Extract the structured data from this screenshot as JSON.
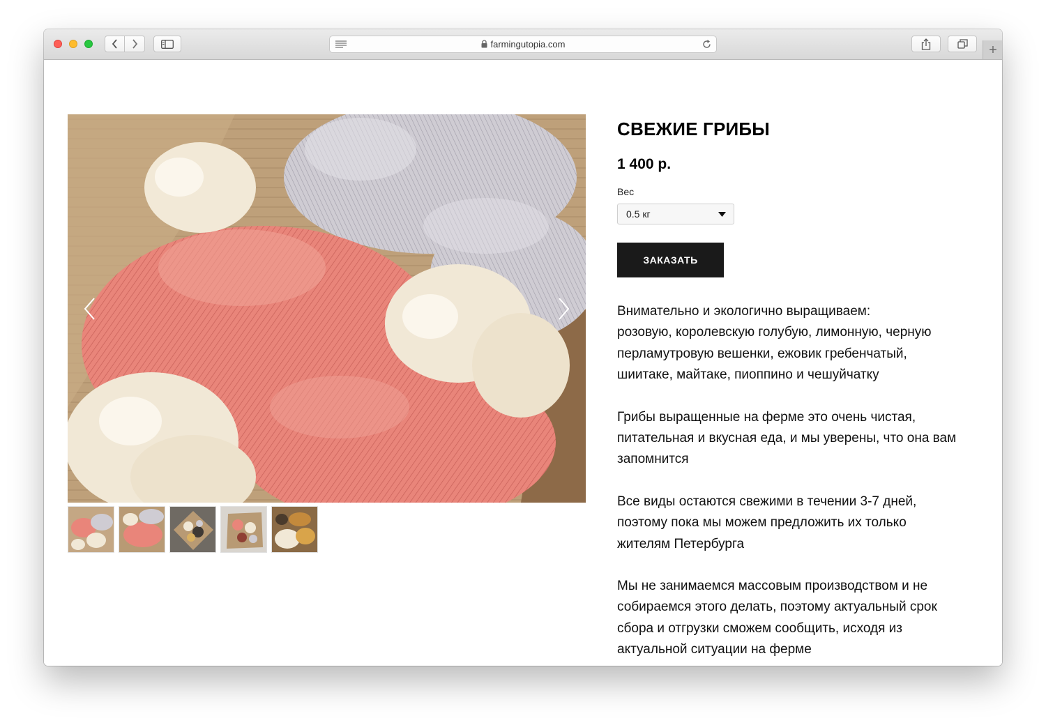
{
  "browser": {
    "url": "farmingutopia.com",
    "icons": {
      "back": "chevron-left-icon",
      "forward": "chevron-right-icon",
      "sidebar": "sidebar-icon",
      "reader": "reader-icon",
      "lock": "lock-icon",
      "reload": "reload-icon",
      "share": "share-icon",
      "tabs": "tabs-icon",
      "new_tab": "plus-icon"
    }
  },
  "product": {
    "title": "СВЕЖИЕ ГРИБЫ",
    "price": "1 400 р.",
    "weight_label": "Вес",
    "weight_selected": "0.5 кг",
    "order_button": "ЗАКАЗАТЬ",
    "description": [
      [
        "Внимательно и экологично выращиваем:",
        "розовую, королевскую голубую, лимонную, черную",
        "перламутровую вешенки, ежовик гребенчатый,",
        "шиитаке, майтаке, пиоппино и чешуйчатку"
      ],
      [
        "Грибы выращенные на ферме это очень чистая,",
        "питательная и вкусная еда, и мы уверены, что она вам",
        "запомнится"
      ],
      [
        "Все виды остаются свежими в течении 3-7 дней,",
        "поэтому пока мы можем предложить их только",
        "жителям Петербурга"
      ],
      [
        "Мы не занимаемся массовым производством и не",
        "собираемся этого делать, поэтому актуальный срок",
        "сбора и отгрузки сможем сообщить, исходя из",
        "актуальной ситуации на ферме"
      ]
    ]
  },
  "gallery": {
    "thumbnail_count": 5,
    "colors": {
      "cardboard": "#b89a74",
      "pink_oyster": "#e9857a",
      "lions_mane": "#f1e8d6",
      "blue_oyster": "#c8c5cc"
    }
  }
}
